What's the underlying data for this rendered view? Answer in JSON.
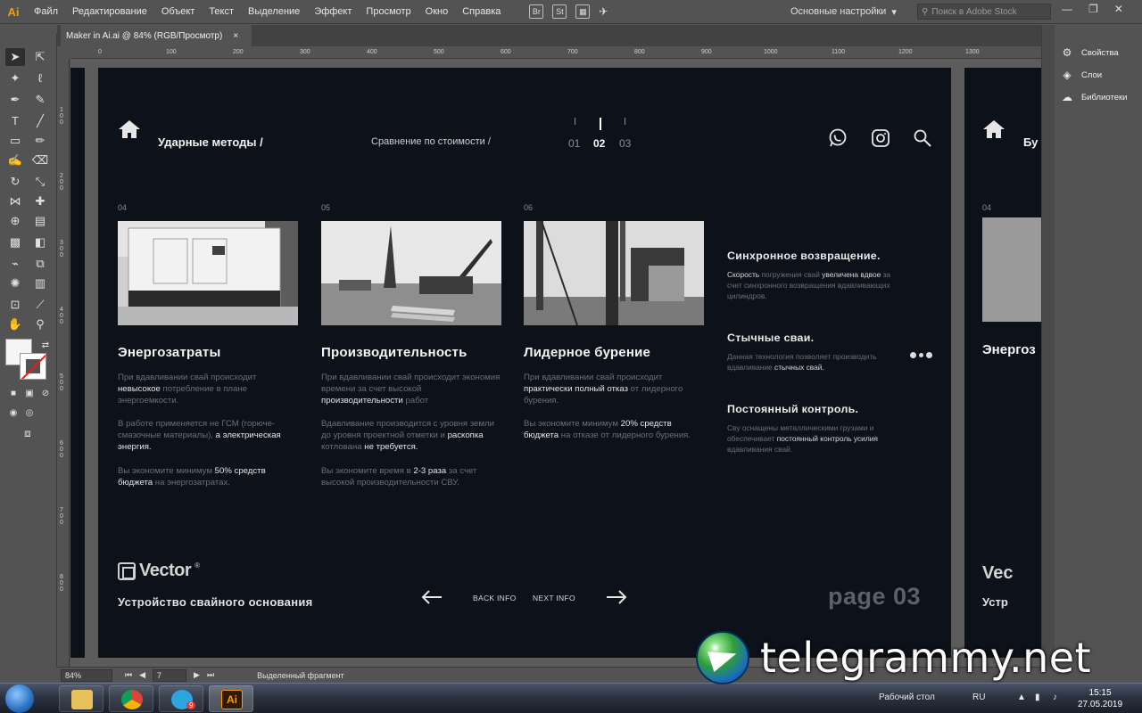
{
  "app": {
    "logo": "Ai",
    "menu": [
      "Файл",
      "Редактирование",
      "Объект",
      "Текст",
      "Выделение",
      "Эффект",
      "Просмотр",
      "Окно",
      "Справка"
    ],
    "bridge_icons": [
      "Br",
      "St"
    ],
    "workspace": "Основные настройки",
    "stock_search_placeholder": "Поиск в Adobe Stock"
  },
  "document_tab": {
    "title": "Maker in Ai.ai @ 84% (RGB/Просмотр)",
    "close": "×"
  },
  "rulers": {
    "h_marks": [
      "0",
      "100",
      "200",
      "300",
      "400",
      "500",
      "600",
      "700",
      "800",
      "900",
      "1000",
      "1100",
      "1200",
      "1300"
    ],
    "v_marks": [
      "100",
      "200",
      "300",
      "400",
      "500",
      "600",
      "700",
      "800"
    ]
  },
  "artboard": {
    "breadcrumb_1": "Ударные методы /",
    "breadcrumb_2": "Сравнение по стоимости /",
    "pager": [
      "01",
      "02",
      "03"
    ],
    "pager_current": "02",
    "columns": [
      {
        "index": "04",
        "title": "Энергозатраты",
        "p1a": "При вдавливании свай происходит",
        "p1b": "невысокое",
        "p1c": " потребление в плане энергоемкости.",
        "p2a": "В работе применяется не ГСМ (горюче-смазочные материалы),",
        "p2b": "а электрическая энергия.",
        "p3a": "Вы экономите минимум",
        "p3b": "50% средств бюджета",
        "p3c": " на энергозатратах."
      },
      {
        "index": "05",
        "title": "Производительность",
        "p1a": "При вдавливании свай происходит экономия времени за счет высокой",
        "p1b": "производительности",
        "p1c": " работ",
        "p2a": "Вдавливание производится с уровня земли до уровня проектной отметки и",
        "p2b": "раскопка",
        "p2c": " котлована ",
        "p2d": "не требуется.",
        "p3a": "Вы экономите время в",
        "p3b": "2-3 раза",
        "p3c": " за счет высокой производительности СВУ."
      },
      {
        "index": "06",
        "title": "Лидерное бурение",
        "p1a": "При вдавливании свай происходит",
        "p1b": "практически полный отказ",
        "p1c": " от лидерного бурения.",
        "p2a": "Вы экономите минимум",
        "p2b": "20% средств бюджета",
        "p2c": " на отказе от лидерного бурения."
      }
    ],
    "features": [
      {
        "title": "Синхронное возвращение.",
        "t1": "Скорость",
        "t2": " погружения свай ",
        "t3": "увеличена вдвое",
        "t4": " за счет синхронного возвращения вдавливающих цилиндров."
      },
      {
        "title": "Стычные сваи.",
        "t1": "",
        "t2": "Данная технология позволяет производить вдавливание ",
        "t3": "стычных свай.",
        "t4": ""
      },
      {
        "title": "Постоянный контроль.",
        "t1": "",
        "t2": "Сву оснащены металлическими грузами и обеспечивает ",
        "t3": "постоянный контроль усилия",
        "t4": " вдавливания свай."
      }
    ],
    "logo_text": "Vector",
    "logo_reg": "®",
    "subtitle": "Устройство свайного основания",
    "back_label": "BACK INFO",
    "next_label": "NEXT INFO",
    "page_label": "page 03"
  },
  "artboard2": {
    "index": "04",
    "title": "Энергоз",
    "logo_text": "Vec",
    "subtitle": "Устр"
  },
  "right_panel": {
    "items": [
      {
        "label": "Свойства",
        "icon": "properties-icon"
      },
      {
        "label": "Слои",
        "icon": "layers-icon"
      },
      {
        "label": "Библиотеки",
        "icon": "libraries-icon"
      }
    ]
  },
  "status": {
    "zoom": "84%",
    "page": "7",
    "selection": "Выделенный фрагмент"
  },
  "taskbar": {
    "desktop_label": "Рабочий стол",
    "lang": "RU",
    "time": "15:15",
    "date": "27.05.2019",
    "telegram_badge": "9"
  },
  "watermark": "telegrammy.net"
}
